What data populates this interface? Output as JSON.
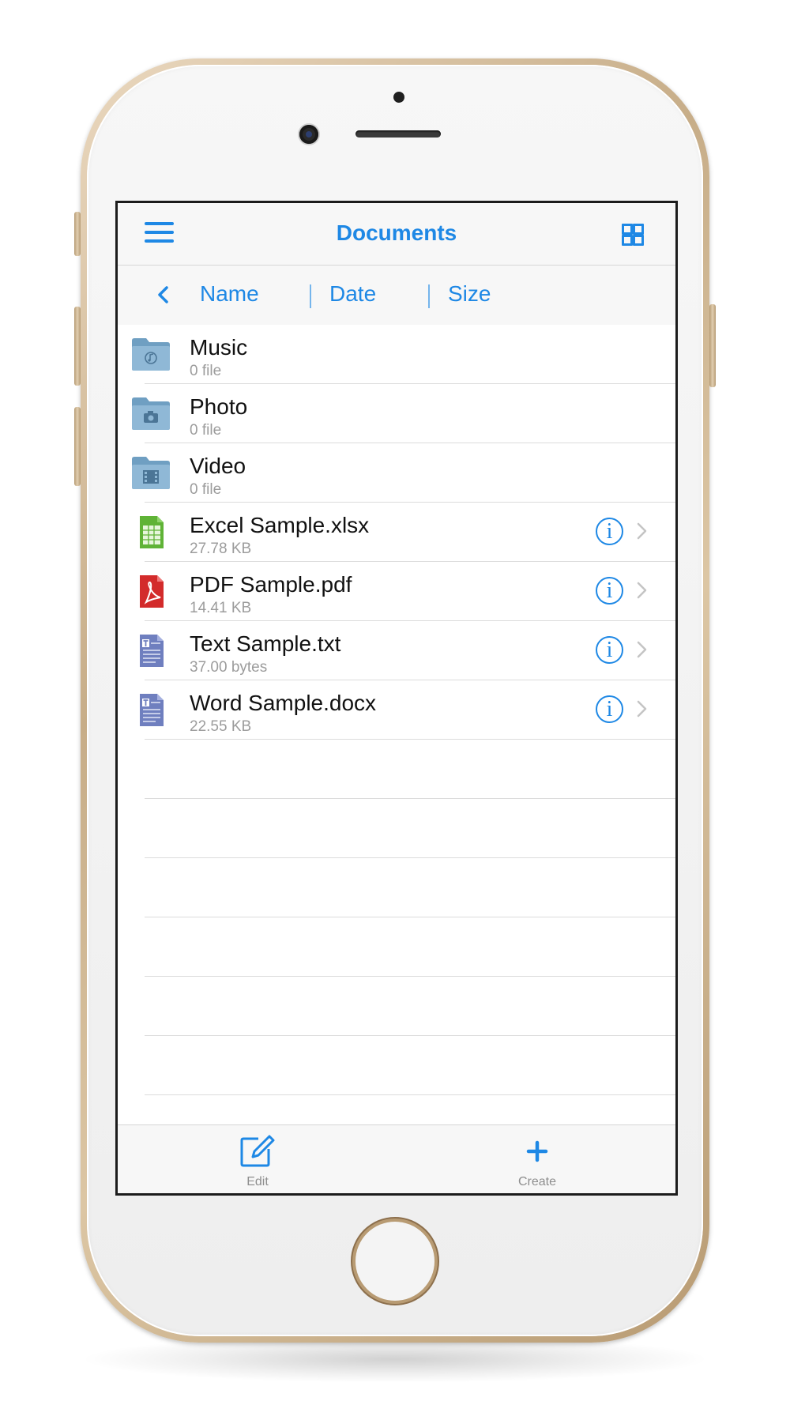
{
  "colors": {
    "accent": "#1e88e5",
    "text": "#111111",
    "subtext": "#9c9c9c",
    "phone_gold": "#c7ad88"
  },
  "header": {
    "title": "Documents",
    "menu_icon": "hamburger-menu-icon",
    "view_icon": "grid-view-icon"
  },
  "sort": {
    "back_icon": "chevron-left-icon",
    "options": [
      {
        "label": "Name"
      },
      {
        "label": "Date"
      },
      {
        "label": "Size"
      }
    ]
  },
  "files": [
    {
      "name": "Music",
      "sub": "0 file",
      "icon": "music-folder-icon",
      "kind": "folder"
    },
    {
      "name": "Photo",
      "sub": "0 file",
      "icon": "camera-folder-icon",
      "kind": "folder"
    },
    {
      "name": "Video",
      "sub": "0 file",
      "icon": "video-folder-icon",
      "kind": "folder"
    },
    {
      "name": "Excel Sample.xlsx",
      "sub": "27.78 KB",
      "icon": "excel-file-icon",
      "kind": "file"
    },
    {
      "name": "PDF Sample.pdf",
      "sub": "14.41 KB",
      "icon": "pdf-file-icon",
      "kind": "file"
    },
    {
      "name": "Text Sample.txt",
      "sub": "37.00 bytes",
      "icon": "text-file-icon",
      "kind": "file"
    },
    {
      "name": "Word Sample.docx",
      "sub": "22.55 KB",
      "icon": "word-file-icon",
      "kind": "file"
    }
  ],
  "info_glyph": "i",
  "toolbar": {
    "edit_label": "Edit",
    "edit_icon": "edit-compose-icon",
    "create_label": "Create",
    "create_icon": "plus-icon"
  }
}
